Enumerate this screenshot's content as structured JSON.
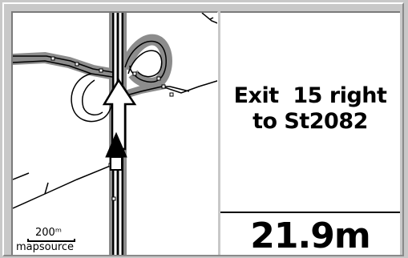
{
  "map": {
    "scale_label": "200ᵐ",
    "source_label": "mapsource",
    "position_marker": "navigation-arrow-icon",
    "turn_arrow": "turn-arrow-icon"
  },
  "guidance": {
    "line1": "Exit  15 right",
    "line2": "to St2082",
    "distance": "21.9m"
  },
  "colors": {
    "background": "#c8c8c8",
    "panel": "#ffffff",
    "road_highlight": "#8c8c8c",
    "text": "#000000"
  }
}
